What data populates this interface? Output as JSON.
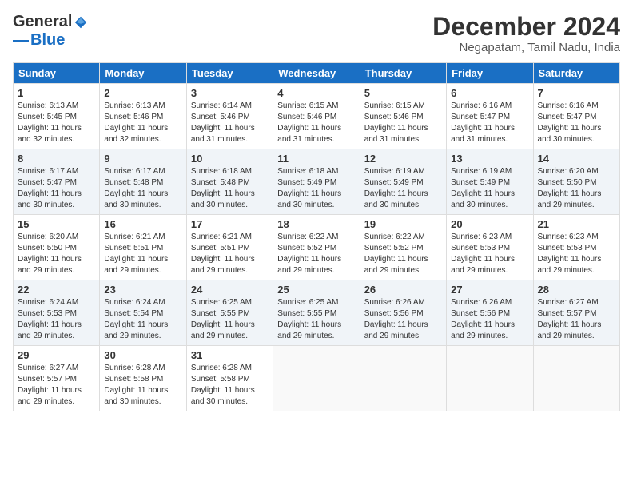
{
  "logo": {
    "general": "General",
    "blue": "Blue"
  },
  "title": "December 2024",
  "location": "Negapatam, Tamil Nadu, India",
  "days_of_week": [
    "Sunday",
    "Monday",
    "Tuesday",
    "Wednesday",
    "Thursday",
    "Friday",
    "Saturday"
  ],
  "weeks": [
    [
      {
        "day": "1",
        "lines": [
          "Sunrise: 6:13 AM",
          "Sunset: 5:45 PM",
          "Daylight: 11 hours",
          "and 32 minutes."
        ]
      },
      {
        "day": "2",
        "lines": [
          "Sunrise: 6:13 AM",
          "Sunset: 5:46 PM",
          "Daylight: 11 hours",
          "and 32 minutes."
        ]
      },
      {
        "day": "3",
        "lines": [
          "Sunrise: 6:14 AM",
          "Sunset: 5:46 PM",
          "Daylight: 11 hours",
          "and 31 minutes."
        ]
      },
      {
        "day": "4",
        "lines": [
          "Sunrise: 6:15 AM",
          "Sunset: 5:46 PM",
          "Daylight: 11 hours",
          "and 31 minutes."
        ]
      },
      {
        "day": "5",
        "lines": [
          "Sunrise: 6:15 AM",
          "Sunset: 5:46 PM",
          "Daylight: 11 hours",
          "and 31 minutes."
        ]
      },
      {
        "day": "6",
        "lines": [
          "Sunrise: 6:16 AM",
          "Sunset: 5:47 PM",
          "Daylight: 11 hours",
          "and 31 minutes."
        ]
      },
      {
        "day": "7",
        "lines": [
          "Sunrise: 6:16 AM",
          "Sunset: 5:47 PM",
          "Daylight: 11 hours",
          "and 30 minutes."
        ]
      }
    ],
    [
      {
        "day": "8",
        "lines": [
          "Sunrise: 6:17 AM",
          "Sunset: 5:47 PM",
          "Daylight: 11 hours",
          "and 30 minutes."
        ]
      },
      {
        "day": "9",
        "lines": [
          "Sunrise: 6:17 AM",
          "Sunset: 5:48 PM",
          "Daylight: 11 hours",
          "and 30 minutes."
        ]
      },
      {
        "day": "10",
        "lines": [
          "Sunrise: 6:18 AM",
          "Sunset: 5:48 PM",
          "Daylight: 11 hours",
          "and 30 minutes."
        ]
      },
      {
        "day": "11",
        "lines": [
          "Sunrise: 6:18 AM",
          "Sunset: 5:49 PM",
          "Daylight: 11 hours",
          "and 30 minutes."
        ]
      },
      {
        "day": "12",
        "lines": [
          "Sunrise: 6:19 AM",
          "Sunset: 5:49 PM",
          "Daylight: 11 hours",
          "and 30 minutes."
        ]
      },
      {
        "day": "13",
        "lines": [
          "Sunrise: 6:19 AM",
          "Sunset: 5:49 PM",
          "Daylight: 11 hours",
          "and 30 minutes."
        ]
      },
      {
        "day": "14",
        "lines": [
          "Sunrise: 6:20 AM",
          "Sunset: 5:50 PM",
          "Daylight: 11 hours",
          "and 29 minutes."
        ]
      }
    ],
    [
      {
        "day": "15",
        "lines": [
          "Sunrise: 6:20 AM",
          "Sunset: 5:50 PM",
          "Daylight: 11 hours",
          "and 29 minutes."
        ]
      },
      {
        "day": "16",
        "lines": [
          "Sunrise: 6:21 AM",
          "Sunset: 5:51 PM",
          "Daylight: 11 hours",
          "and 29 minutes."
        ]
      },
      {
        "day": "17",
        "lines": [
          "Sunrise: 6:21 AM",
          "Sunset: 5:51 PM",
          "Daylight: 11 hours",
          "and 29 minutes."
        ]
      },
      {
        "day": "18",
        "lines": [
          "Sunrise: 6:22 AM",
          "Sunset: 5:52 PM",
          "Daylight: 11 hours",
          "and 29 minutes."
        ]
      },
      {
        "day": "19",
        "lines": [
          "Sunrise: 6:22 AM",
          "Sunset: 5:52 PM",
          "Daylight: 11 hours",
          "and 29 minutes."
        ]
      },
      {
        "day": "20",
        "lines": [
          "Sunrise: 6:23 AM",
          "Sunset: 5:53 PM",
          "Daylight: 11 hours",
          "and 29 minutes."
        ]
      },
      {
        "day": "21",
        "lines": [
          "Sunrise: 6:23 AM",
          "Sunset: 5:53 PM",
          "Daylight: 11 hours",
          "and 29 minutes."
        ]
      }
    ],
    [
      {
        "day": "22",
        "lines": [
          "Sunrise: 6:24 AM",
          "Sunset: 5:53 PM",
          "Daylight: 11 hours",
          "and 29 minutes."
        ]
      },
      {
        "day": "23",
        "lines": [
          "Sunrise: 6:24 AM",
          "Sunset: 5:54 PM",
          "Daylight: 11 hours",
          "and 29 minutes."
        ]
      },
      {
        "day": "24",
        "lines": [
          "Sunrise: 6:25 AM",
          "Sunset: 5:55 PM",
          "Daylight: 11 hours",
          "and 29 minutes."
        ]
      },
      {
        "day": "25",
        "lines": [
          "Sunrise: 6:25 AM",
          "Sunset: 5:55 PM",
          "Daylight: 11 hours",
          "and 29 minutes."
        ]
      },
      {
        "day": "26",
        "lines": [
          "Sunrise: 6:26 AM",
          "Sunset: 5:56 PM",
          "Daylight: 11 hours",
          "and 29 minutes."
        ]
      },
      {
        "day": "27",
        "lines": [
          "Sunrise: 6:26 AM",
          "Sunset: 5:56 PM",
          "Daylight: 11 hours",
          "and 29 minutes."
        ]
      },
      {
        "day": "28",
        "lines": [
          "Sunrise: 6:27 AM",
          "Sunset: 5:57 PM",
          "Daylight: 11 hours",
          "and 29 minutes."
        ]
      }
    ],
    [
      {
        "day": "29",
        "lines": [
          "Sunrise: 6:27 AM",
          "Sunset: 5:57 PM",
          "Daylight: 11 hours",
          "and 29 minutes."
        ]
      },
      {
        "day": "30",
        "lines": [
          "Sunrise: 6:28 AM",
          "Sunset: 5:58 PM",
          "Daylight: 11 hours",
          "and 30 minutes."
        ]
      },
      {
        "day": "31",
        "lines": [
          "Sunrise: 6:28 AM",
          "Sunset: 5:58 PM",
          "Daylight: 11 hours",
          "and 30 minutes."
        ]
      },
      {
        "day": "",
        "lines": []
      },
      {
        "day": "",
        "lines": []
      },
      {
        "day": "",
        "lines": []
      },
      {
        "day": "",
        "lines": []
      }
    ]
  ]
}
